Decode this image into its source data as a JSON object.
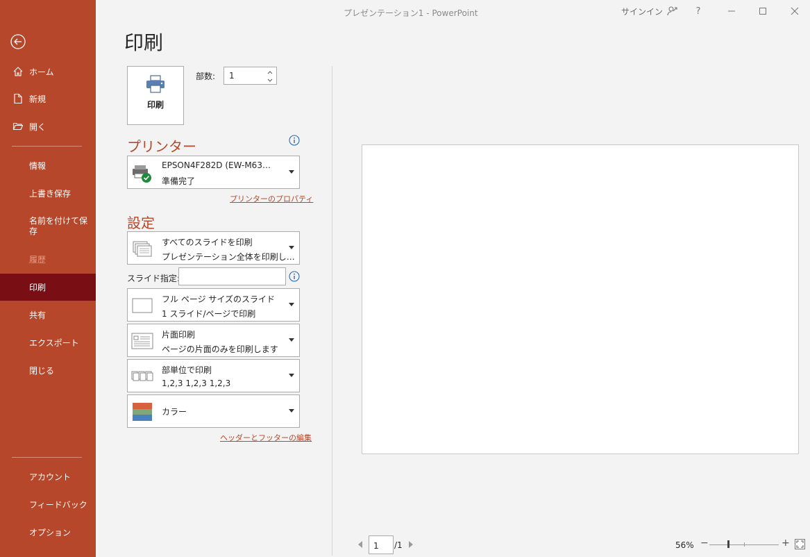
{
  "window": {
    "title": "プレゼンテーション1  -  PowerPoint",
    "signin": "サインイン",
    "help": "?"
  },
  "sidebar": {
    "items": [
      {
        "label": "ホーム"
      },
      {
        "label": "新規"
      },
      {
        "label": "開く"
      },
      {
        "label": "情報"
      },
      {
        "label": "上書き保存"
      },
      {
        "label": "名前を付けて保存"
      },
      {
        "label": "履歴"
      },
      {
        "label": "印刷"
      },
      {
        "label": "共有"
      },
      {
        "label": "エクスポート"
      },
      {
        "label": "閉じる"
      },
      {
        "label": "アカウント"
      },
      {
        "label": "フィードバック"
      },
      {
        "label": "オプション"
      }
    ]
  },
  "main": {
    "title": "印刷",
    "print_button": "印刷",
    "copies_label": "部数:",
    "copies_value": "1",
    "printer_header": "プリンター",
    "printer_name": "EPSON4F282D (EW-M63…",
    "printer_status": "準備完了",
    "printer_properties": "プリンターのプロパティ",
    "settings_header": "設定",
    "range": {
      "l1": "すべてのスライドを印刷",
      "l2": "プレゼンテーション全体を印刷し…"
    },
    "slides_label": "スライド指定:",
    "slides_value": "",
    "layout": {
      "l1": "フル ページ サイズのスライド",
      "l2": "1 スライド/ページで印刷"
    },
    "sides": {
      "l1": "片面印刷",
      "l2": "ページの片面のみを印刷します"
    },
    "collate": {
      "l1": "部単位で印刷",
      "l2": "1,2,3   1,2,3   1,2,3"
    },
    "color": {
      "l1": "カラー"
    },
    "header_footer": "ヘッダーとフッターの編集"
  },
  "preview": {
    "page_value": "1",
    "page_total": "/1",
    "zoom": "56%",
    "zoom_minus": "−",
    "zoom_plus": "+"
  },
  "colors": {
    "sidebar": "#b7472a",
    "sidebar_active": "#7a0e15",
    "accent": "#b7472a"
  }
}
